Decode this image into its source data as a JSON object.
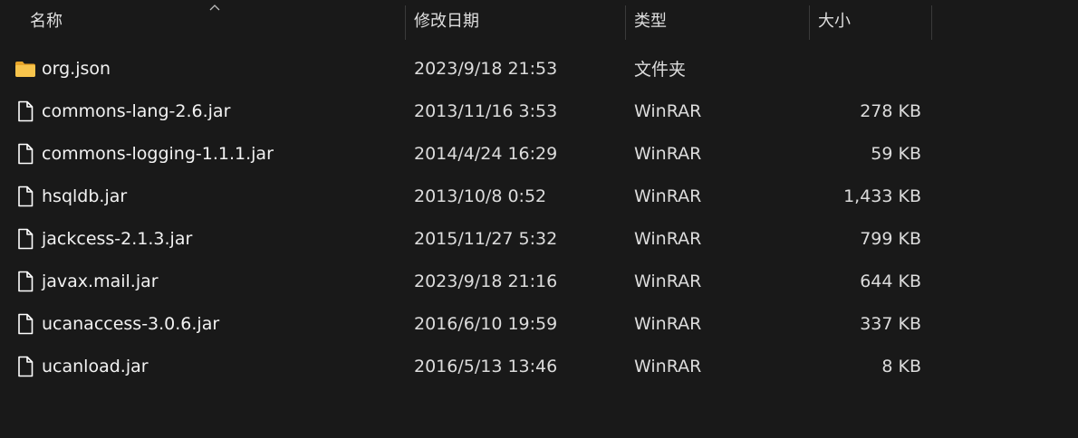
{
  "columns": {
    "name": "名称",
    "modified": "修改日期",
    "type": "类型",
    "size": "大小"
  },
  "sort": {
    "column": "name",
    "indicator": "chevron-up-icon"
  },
  "files": [
    {
      "name": "org.json",
      "modified": "2023/9/18 21:53",
      "type": "文件夹",
      "size": "",
      "icon": "folder-icon"
    },
    {
      "name": "commons-lang-2.6.jar",
      "modified": "2013/11/16 3:53",
      "type": "WinRAR",
      "size": "278 KB",
      "icon": "file-icon"
    },
    {
      "name": "commons-logging-1.1.1.jar",
      "modified": "2014/4/24 16:29",
      "type": "WinRAR",
      "size": "59 KB",
      "icon": "file-icon"
    },
    {
      "name": "hsqldb.jar",
      "modified": "2013/10/8 0:52",
      "type": "WinRAR",
      "size": "1,433 KB",
      "icon": "file-icon"
    },
    {
      "name": "jackcess-2.1.3.jar",
      "modified": "2015/11/27 5:32",
      "type": "WinRAR",
      "size": "799 KB",
      "icon": "file-icon"
    },
    {
      "name": "javax.mail.jar",
      "modified": "2023/9/18 21:16",
      "type": "WinRAR",
      "size": "644 KB",
      "icon": "file-icon"
    },
    {
      "name": "ucanaccess-3.0.6.jar",
      "modified": "2016/6/10 19:59",
      "type": "WinRAR",
      "size": "337 KB",
      "icon": "file-icon"
    },
    {
      "name": "ucanload.jar",
      "modified": "2016/5/13 13:46",
      "type": "WinRAR",
      "size": "8 KB",
      "icon": "file-icon"
    }
  ],
  "colors": {
    "background": "#191919",
    "folder": "#f5c045",
    "file_icon": "#ffffff"
  }
}
